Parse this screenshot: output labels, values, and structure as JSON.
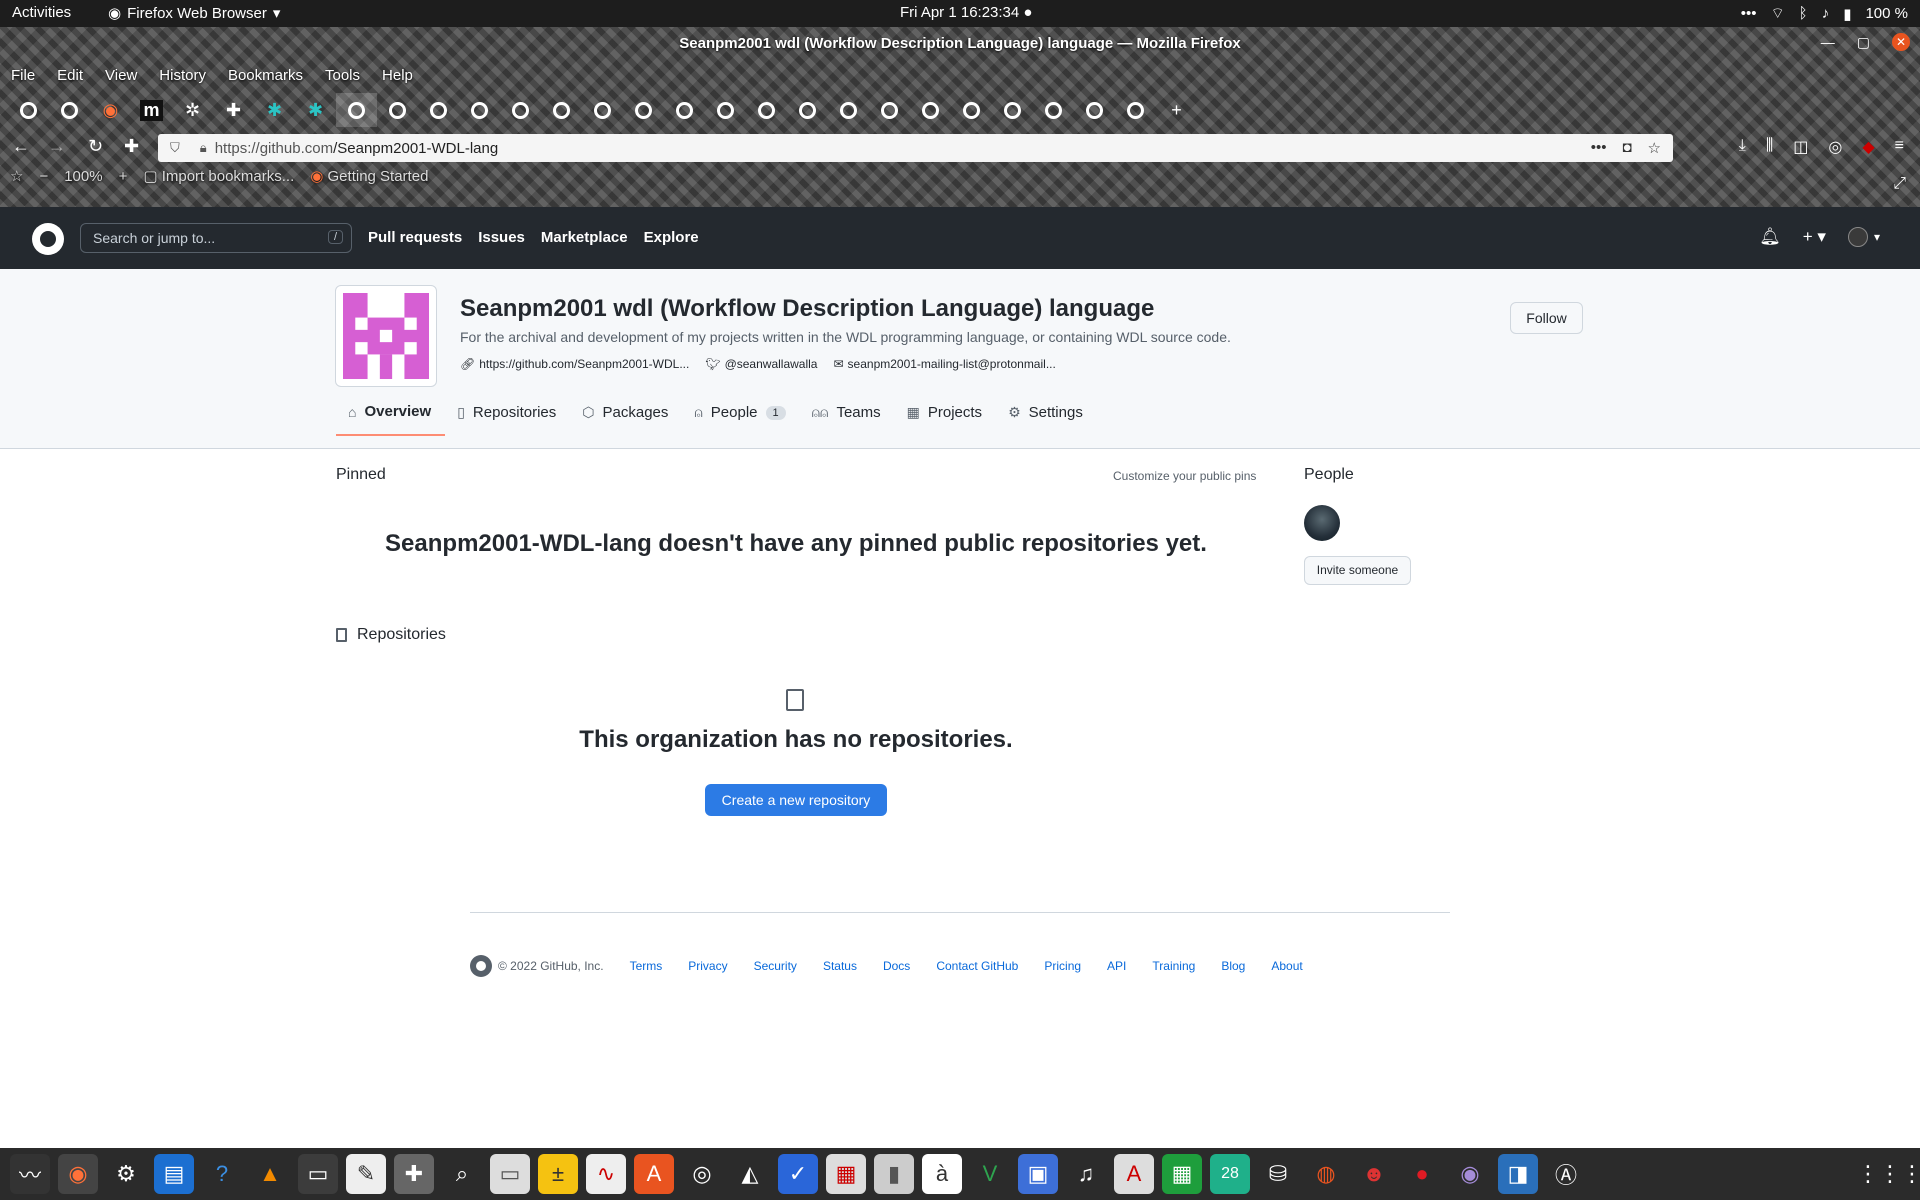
{
  "system": {
    "activities": "Activities",
    "app_name": "Firefox Web Browser",
    "clock": "Fri Apr 1  16:23:34",
    "battery": "100 %"
  },
  "window": {
    "title": "Seanpm2001 wdl (Workflow Description Language) language — Mozilla Firefox"
  },
  "menu": [
    "File",
    "Edit",
    "View",
    "History",
    "Bookmarks",
    "Tools",
    "Help"
  ],
  "toolbar": {
    "url_host": "https://github.com",
    "url_path": "/Seanpm2001-WDL-lang",
    "zoom": "100%",
    "bookmarks": [
      "Import bookmarks...",
      "Getting Started"
    ]
  },
  "github": {
    "search_placeholder": "Search or jump to...",
    "search_key": "/",
    "nav": [
      "Pull requests",
      "Issues",
      "Marketplace",
      "Explore"
    ]
  },
  "org": {
    "name": "Seanpm2001 wdl (Workflow Description Language) language",
    "description": "For the archival and development of my projects written in the WDL programming language, or containing WDL source code.",
    "website": "https://github.com/Seanpm2001-WDL...",
    "twitter": "@seanwallawalla",
    "email": "seanpm2001-mailing-list@protonmail...",
    "follow": "Follow",
    "tabs": [
      {
        "label": "Overview",
        "icon": "home-icon"
      },
      {
        "label": "Repositories",
        "icon": "repo-icon"
      },
      {
        "label": "Packages",
        "icon": "package-icon"
      },
      {
        "label": "People",
        "icon": "person-icon",
        "count": "1"
      },
      {
        "label": "Teams",
        "icon": "people-icon"
      },
      {
        "label": "Projects",
        "icon": "table-icon"
      },
      {
        "label": "Settings",
        "icon": "gear-icon"
      }
    ]
  },
  "main": {
    "pinned_heading": "Pinned",
    "customize": "Customize your public pins",
    "no_pins": "Seanpm2001-WDL-lang doesn't have any pinned public repositories yet.",
    "repos_heading": "Repositories",
    "no_repos": "This organization has no repositories.",
    "create_repo": "Create a new repository"
  },
  "sidebar": {
    "people_heading": "People",
    "invite": "Invite someone"
  },
  "footer": {
    "copyright": "© 2022 GitHub, Inc.",
    "links": [
      "Terms",
      "Privacy",
      "Security",
      "Status",
      "Docs",
      "Contact GitHub",
      "Pricing",
      "API",
      "Training",
      "Blog",
      "About"
    ]
  },
  "colors": {
    "accent": "#2c7be5",
    "header_bg": "#24292f",
    "org_logo": "#d65fd3"
  }
}
